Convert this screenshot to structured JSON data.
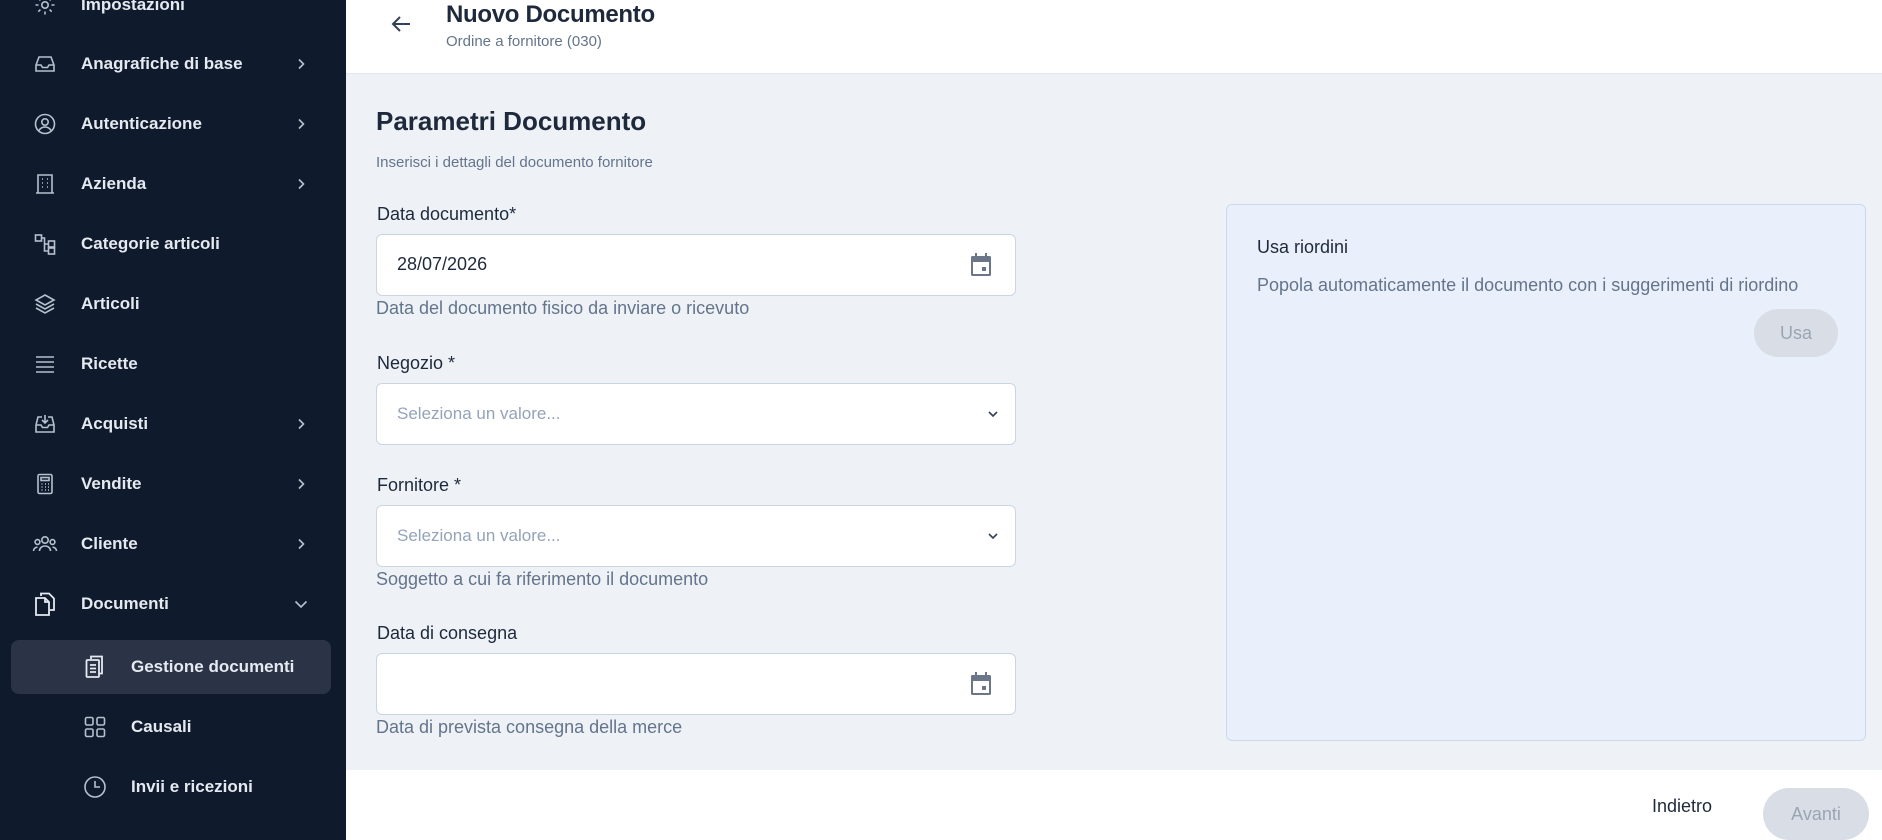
{
  "sidebar": {
    "items": [
      {
        "label": "Impostazioni",
        "icon": "gear-icon",
        "has_chevron": false
      },
      {
        "label": "Anagrafiche di base",
        "icon": "inbox-icon",
        "has_chevron": true
      },
      {
        "label": "Autenticazione",
        "icon": "user-circle-icon",
        "has_chevron": true
      },
      {
        "label": "Azienda",
        "icon": "building-icon",
        "has_chevron": true
      },
      {
        "label": "Categorie articoli",
        "icon": "hierarchy-icon",
        "has_chevron": false
      },
      {
        "label": "Articoli",
        "icon": "layers-icon",
        "has_chevron": false
      },
      {
        "label": "Ricette",
        "icon": "list-icon",
        "has_chevron": false
      },
      {
        "label": "Acquisti",
        "icon": "tray-download-icon",
        "has_chevron": true
      },
      {
        "label": "Vendite",
        "icon": "calculator-icon",
        "has_chevron": true
      },
      {
        "label": "Cliente",
        "icon": "users-icon",
        "has_chevron": true
      },
      {
        "label": "Documenti",
        "icon": "documents-icon",
        "has_chevron": true,
        "expanded": true
      }
    ],
    "subitems": [
      {
        "label": "Gestione documenti",
        "icon": "clipboard-icon",
        "active": true
      },
      {
        "label": "Causali",
        "icon": "grid-icon",
        "active": false
      },
      {
        "label": "Invii e ricezioni",
        "icon": "clock-icon",
        "active": false
      }
    ]
  },
  "header": {
    "title": "Nuovo Documento",
    "subtitle": "Ordine a fornitore (030)"
  },
  "form": {
    "title": "Parametri Documento",
    "subtitle": "Inserisci i dettagli del documento fornitore",
    "data_documento": {
      "label": "Data documento*",
      "value": "28/07/2026",
      "help": "Data del documento fisico da inviare o ricevuto"
    },
    "negozio": {
      "label": "Negozio *",
      "placeholder": "Seleziona un valore..."
    },
    "fornitore": {
      "label": "Fornitore *",
      "placeholder": "Seleziona un valore...",
      "help": "Soggetto a cui fa riferimento il documento"
    },
    "data_consegna": {
      "label": "Data di consegna",
      "value": "",
      "help": "Data di prevista consegna della merce"
    }
  },
  "reorder_card": {
    "title": "Usa riordini",
    "description": "Popola automaticamente il documento con i suggerimenti di riordino",
    "button": "Usa"
  },
  "footer": {
    "back_label": "Indietro",
    "next_label": "Avanti"
  },
  "colors": {
    "sidebar_bg": "#0f1b2d",
    "active_item_bg": "#2a3446",
    "page_bg": "#eef2f7",
    "card_bg": "#e9f0fb",
    "disabled_button_bg": "#d9dee6"
  }
}
